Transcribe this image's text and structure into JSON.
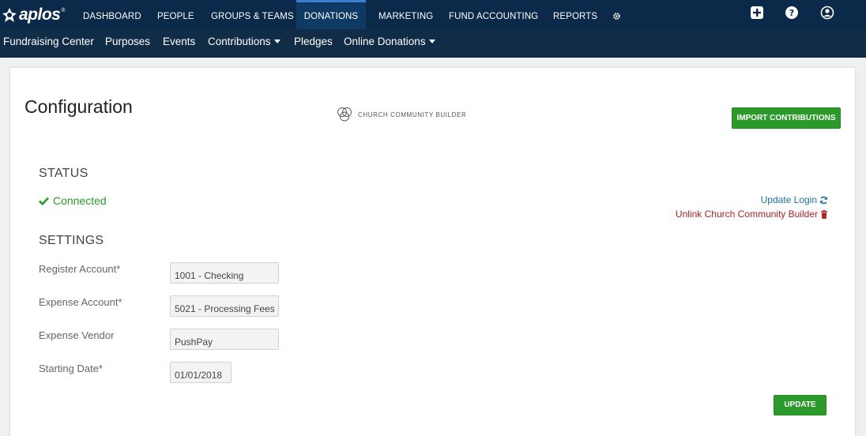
{
  "brand": {
    "name": "aplos"
  },
  "topnav": {
    "items": [
      {
        "label": "DASHBOARD"
      },
      {
        "label": "PEOPLE"
      },
      {
        "label": "GROUPS & TEAMS"
      },
      {
        "label": "DONATIONS"
      },
      {
        "label": "MARKETING"
      },
      {
        "label": "FUND ACCOUNTING"
      },
      {
        "label": "REPORTS"
      }
    ],
    "active": "DONATIONS"
  },
  "subnav": {
    "items": [
      {
        "label": "Fundraising Center"
      },
      {
        "label": "Purposes"
      },
      {
        "label": "Events"
      },
      {
        "label": "Contributions"
      },
      {
        "label": "Pledges"
      },
      {
        "label": "Online Donations"
      }
    ]
  },
  "page": {
    "title": "Configuration",
    "integration_logo_text": "CHURCH COMMUNITY BUILDER",
    "import_button": "IMPORT CONTRIBUTIONS",
    "status_heading": "STATUS",
    "status_value": "Connected",
    "update_login": "Update Login",
    "unlink": "Unlink Church Community Builder",
    "settings_heading": "SETTINGS",
    "fields": [
      {
        "label": "Register Account*",
        "value": "1001 - Checking"
      },
      {
        "label": "Expense Account*",
        "value": "5021 - Processing Fees"
      },
      {
        "label": "Expense Vendor",
        "value": "PushPay"
      },
      {
        "label": "Starting Date*",
        "value": "01/01/2018"
      }
    ],
    "update_button": "UPDATE"
  },
  "colors": {
    "topnav_bg": "#0b2a4a",
    "subnav_bg": "#102c46",
    "accent_green": "#2a9b2a",
    "link_blue": "#1e6fa8",
    "danger_red": "#b22222"
  }
}
